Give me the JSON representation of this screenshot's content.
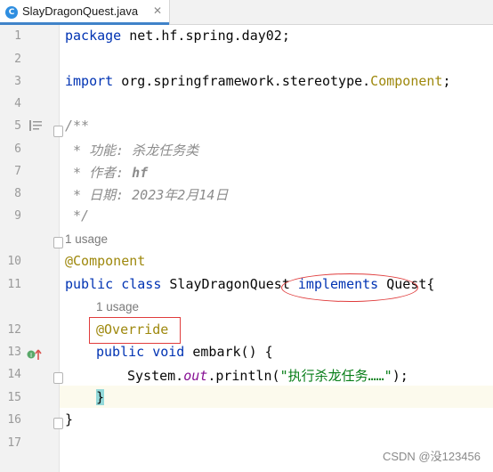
{
  "tab": {
    "filename": "SlayDragonQuest.java",
    "close": "✕",
    "icon_letter": "C"
  },
  "lines": [
    {
      "n": "1"
    },
    {
      "n": "2"
    },
    {
      "n": "3"
    },
    {
      "n": "4"
    },
    {
      "n": "5"
    },
    {
      "n": "6"
    },
    {
      "n": "7"
    },
    {
      "n": "8"
    },
    {
      "n": "9"
    },
    {
      "n": "10"
    },
    {
      "n": "11"
    },
    {
      "n": "12"
    },
    {
      "n": "13"
    },
    {
      "n": "14"
    },
    {
      "n": "15"
    },
    {
      "n": "16"
    },
    {
      "n": "17"
    }
  ],
  "code": {
    "l1_kw": "package",
    "l1_rest": " net.hf.spring.day02;",
    "l3_kw": "import",
    "l3_pkg": " org.springframework.stereotype.",
    "l3_comp": "Component",
    "l3_end": ";",
    "l5": "/**",
    "l6": " * 功能: 杀龙任务类",
    "l7_a": " * 作者: ",
    "l7_b": "hf",
    "l8_a": " * 日期: ",
    "l8_b": "2023",
    "l8_c": "年",
    "l8_d": "2",
    "l8_e": "月",
    "l8_f": "14",
    "l8_g": "日",
    "l9": " */",
    "usage1": "1 usage",
    "l10": "@Component",
    "l11_kw1": "public class",
    "l11_name": " SlayDragonQuest ",
    "l11_kw2": "implements",
    "l11_rest": " Quest{",
    "usage2": "1 usage",
    "l12": "@Override",
    "l13_kw": "public void",
    "l13_rest": " embark() {",
    "l14_a": "System.",
    "l14_out": "out",
    "l14_b": ".println(",
    "l14_str": "\"执行杀龙任务……\"",
    "l14_c": ");",
    "l15": "}",
    "l16": "}"
  },
  "watermark": "CSDN @没123456"
}
